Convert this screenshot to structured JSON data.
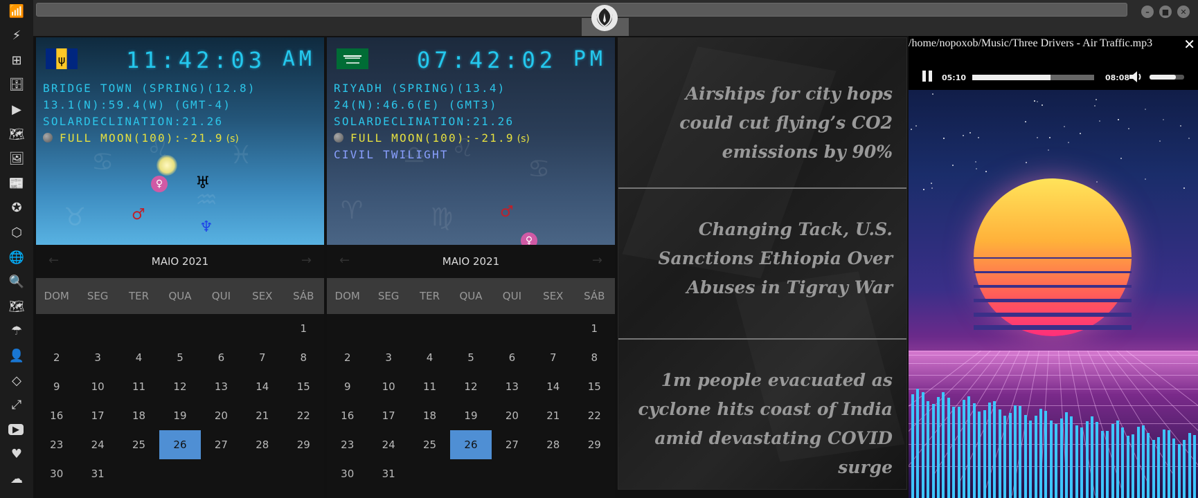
{
  "sidebar": {
    "icons": [
      "wifi-icon",
      "bolt-icon",
      "windows-icon",
      "archive-icon",
      "play-circle-icon",
      "map-book-icon",
      "image-icon",
      "news-icon",
      "rebel-icon",
      "hexagon-icon",
      "globe-icon",
      "search-icon",
      "map-icon",
      "umbrella-icon",
      "contact-icon",
      "code-icon",
      "expand-icon",
      "youtube-icon",
      "heart-icon",
      "cloud-icon"
    ],
    "accent_color": "#3ecf4a"
  },
  "clocks": [
    {
      "flag": "barbados-flag",
      "time": "11:42:03",
      "ampm": "AM",
      "location": "BRIDGE TOWN (SPRING)(12.8)",
      "coords": "13.1(N):59.4(W) (GMT-4)",
      "declination": "SOLARDECLINATION:21.26",
      "moon": "FULL MOON(100):-21.9",
      "moon_suffix": "(s)",
      "twilight": ""
    },
    {
      "flag": "saudi-arabia-flag",
      "time": "07:42:02",
      "ampm": "PM",
      "location": "RIYADH (SPRING)(13.4)",
      "coords": "24(N):46.6(E) (GMT3)",
      "declination": "SOLARDECLINATION:21.26",
      "moon": "FULL MOON(100):-21.9",
      "moon_suffix": "(s)",
      "twilight": "CIVIL TWILIGHT"
    }
  ],
  "calendar": {
    "month": "MAIO 2021",
    "prev": "←",
    "next": "→",
    "days_of_week": [
      "DOM",
      "SEG",
      "TER",
      "QUA",
      "QUI",
      "SEX",
      "SÁB"
    ],
    "weeks": [
      [
        "",
        "",
        "",
        "",
        "",
        "",
        "1"
      ],
      [
        "2",
        "3",
        "4",
        "5",
        "6",
        "7",
        "8"
      ],
      [
        "9",
        "10",
        "11",
        "12",
        "13",
        "14",
        "15"
      ],
      [
        "16",
        "17",
        "18",
        "19",
        "20",
        "21",
        "22"
      ],
      [
        "23",
        "24",
        "25",
        "26",
        "27",
        "28",
        "29"
      ],
      [
        "30",
        "31",
        "",
        "",
        "",
        "",
        ""
      ]
    ],
    "today": "26",
    "today_color": "#4f8fd4"
  },
  "news": {
    "items": [
      "Airships for city hops could cut flying’s CO2 emissions by 90%",
      "Changing Tack, U.S. Sanctions Ethiopia Over Abuses in Tigray War",
      "1m people evacuated as cyclone hits coast of India amid devastating COVID surge"
    ]
  },
  "player": {
    "file_path": "/home/nopoxob/Music/Three Drivers - Air Traffic.mp3",
    "close": "✕",
    "current_time": "05:10",
    "total_time": "08:08",
    "progress": 0.64,
    "volume": 0.75
  }
}
